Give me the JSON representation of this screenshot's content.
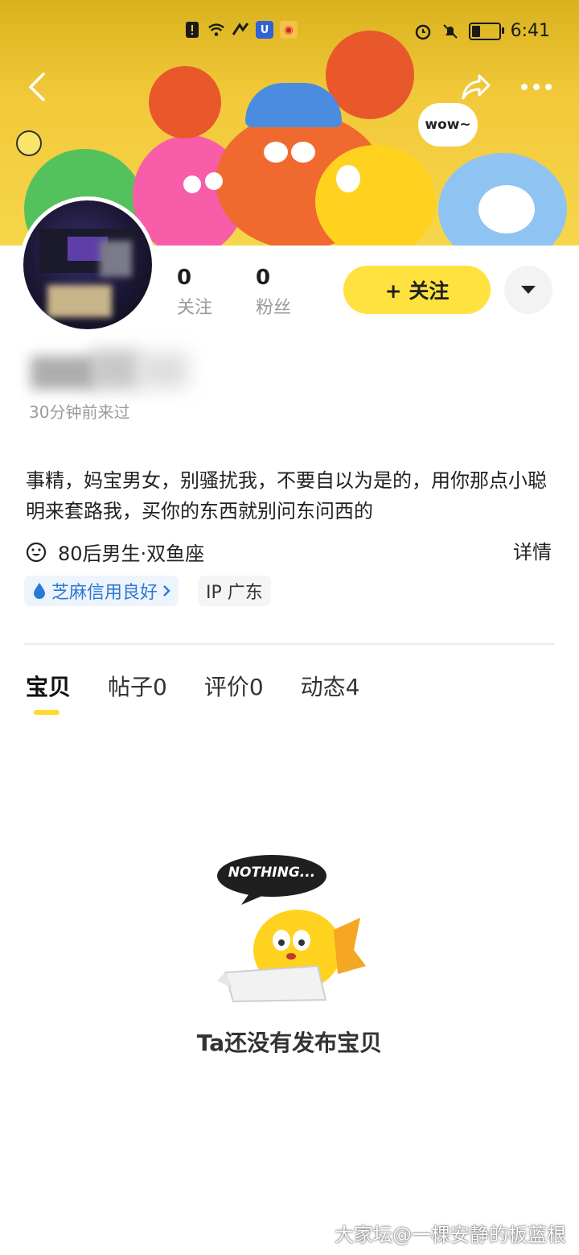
{
  "status_bar": {
    "time": "6:41",
    "icons": [
      "alert-icon",
      "wifi-icon",
      "signal-icon",
      "app-icon-blue",
      "weibo-icon",
      "alarm-icon",
      "mute-icon",
      "battery-icon"
    ],
    "battery_level": 0.3
  },
  "header": {
    "back_icon": "back-arrow-icon",
    "share_icon": "share-icon",
    "more_icon": "more-dots-icon"
  },
  "banner": {
    "bubble_text": "wow~"
  },
  "profile": {
    "following_count": "0",
    "following_label": "关注",
    "followers_count": "0",
    "followers_label": "粉丝",
    "follow_button": "+ 关注",
    "last_seen": "30分钟前来过",
    "bio": "事精，妈宝男女，别骚扰我，不要自以为是的，用你那点小聪明来套路我，买你的东西就别问东问西的",
    "tags_line": "80后男生·双鱼座",
    "details_link": "详情",
    "credit_tag": "芝麻信用良好",
    "ip_tag": "IP 广东"
  },
  "tabs": [
    {
      "label": "宝贝",
      "active": true
    },
    {
      "label": "帖子0",
      "active": false
    },
    {
      "label": "评价0",
      "active": false
    },
    {
      "label": "动态4",
      "active": false
    }
  ],
  "empty_state": {
    "sign_text": "NOTHING...",
    "message": "Ta还没有发布宝贝"
  },
  "watermark": "大家坛@一棵安静的板蓝根",
  "colors": {
    "accent_yellow": "#ffe23f",
    "banner_yellow": "#f2c93a",
    "credit_blue": "#2b79d6"
  }
}
